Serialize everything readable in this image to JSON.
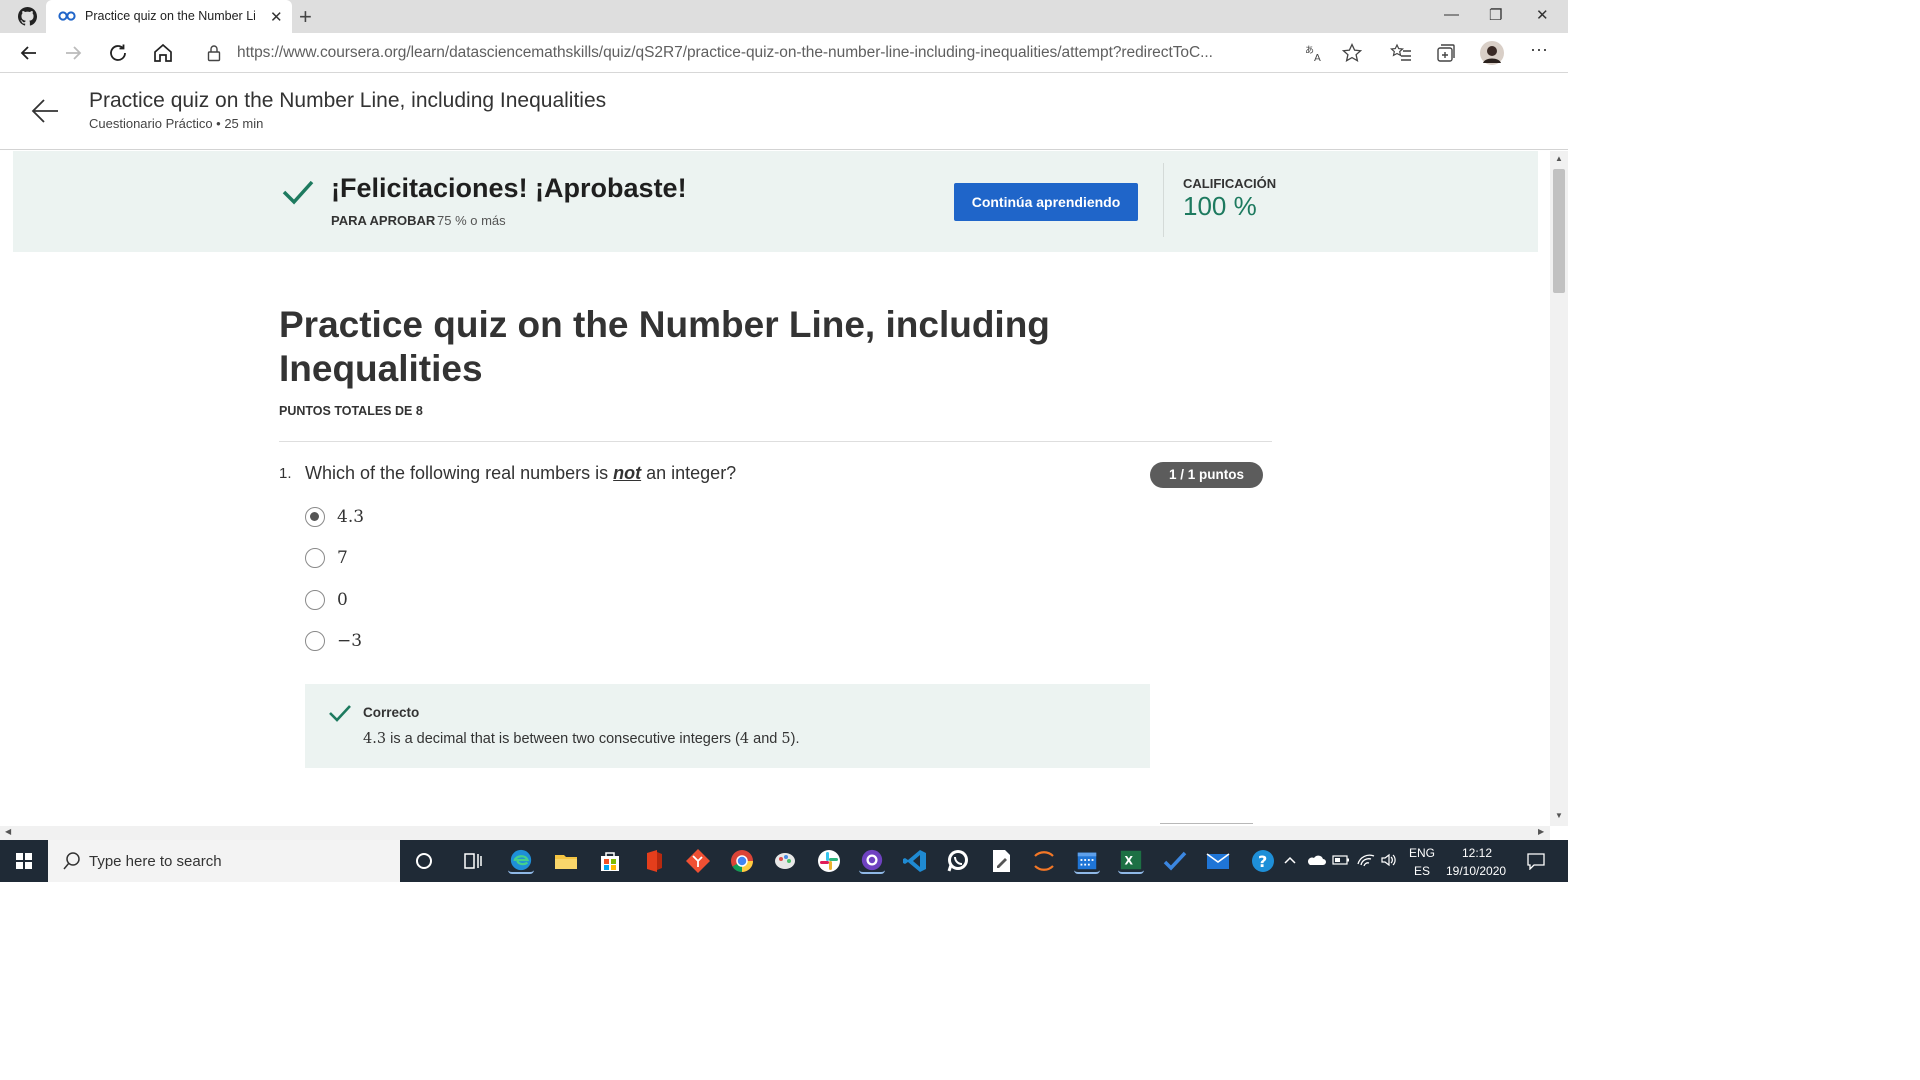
{
  "browser": {
    "tab_title": "Practice quiz on the Number Line, including Inequalities",
    "tab_close": "✕",
    "new_tab": "+",
    "url": "https://www.coursera.org/learn/datasciencemathskills/quiz/qS2R7/practice-quiz-on-the-number-line-including-inequalities/attempt?redirectToC...",
    "window_controls": {
      "minimize": "—",
      "restore": "❐",
      "close": "✕"
    },
    "more": "···"
  },
  "header": {
    "title": "Practice quiz on the Number Line, including Inequalities",
    "subtitle": "Cuestionario Práctico • 25 min"
  },
  "banner": {
    "title": "¡Felicitaciones! ¡Aprobaste!",
    "pass_label": "PARA APROBAR",
    "pass_value": "75 % o más",
    "continue_button": "Continúa aprendiendo",
    "grade_label": "CALIFICACIÓN",
    "grade_value": "100 %",
    "accent_color": "#1d7a5f"
  },
  "quiz": {
    "title": "Practice quiz on the Number Line, including Inequalities",
    "total_points": "PUNTOS TOTALES DE 8",
    "questions": [
      {
        "number": "1.",
        "text_before": "Which of the following real numbers is ",
        "text_emphasis": "not",
        "text_after": " an integer?",
        "points_badge": "1 / 1 puntos",
        "options": [
          {
            "label": "4.3",
            "selected": true
          },
          {
            "label": "7",
            "selected": false
          },
          {
            "label": "0",
            "selected": false
          },
          {
            "label": "−3",
            "selected": false
          }
        ],
        "feedback": {
          "title": "Correcto",
          "value": "4.3",
          "text_1": " is a decimal that is between two consecutive integers (",
          "n1": "4",
          "text_2": " and ",
          "n2": "5",
          "text_3": ")."
        }
      }
    ]
  },
  "taskbar": {
    "search_placeholder": "Type here to search",
    "lang_top": "ENG",
    "lang_bottom": "ES",
    "time": "12:12",
    "date": "19/10/2020"
  }
}
